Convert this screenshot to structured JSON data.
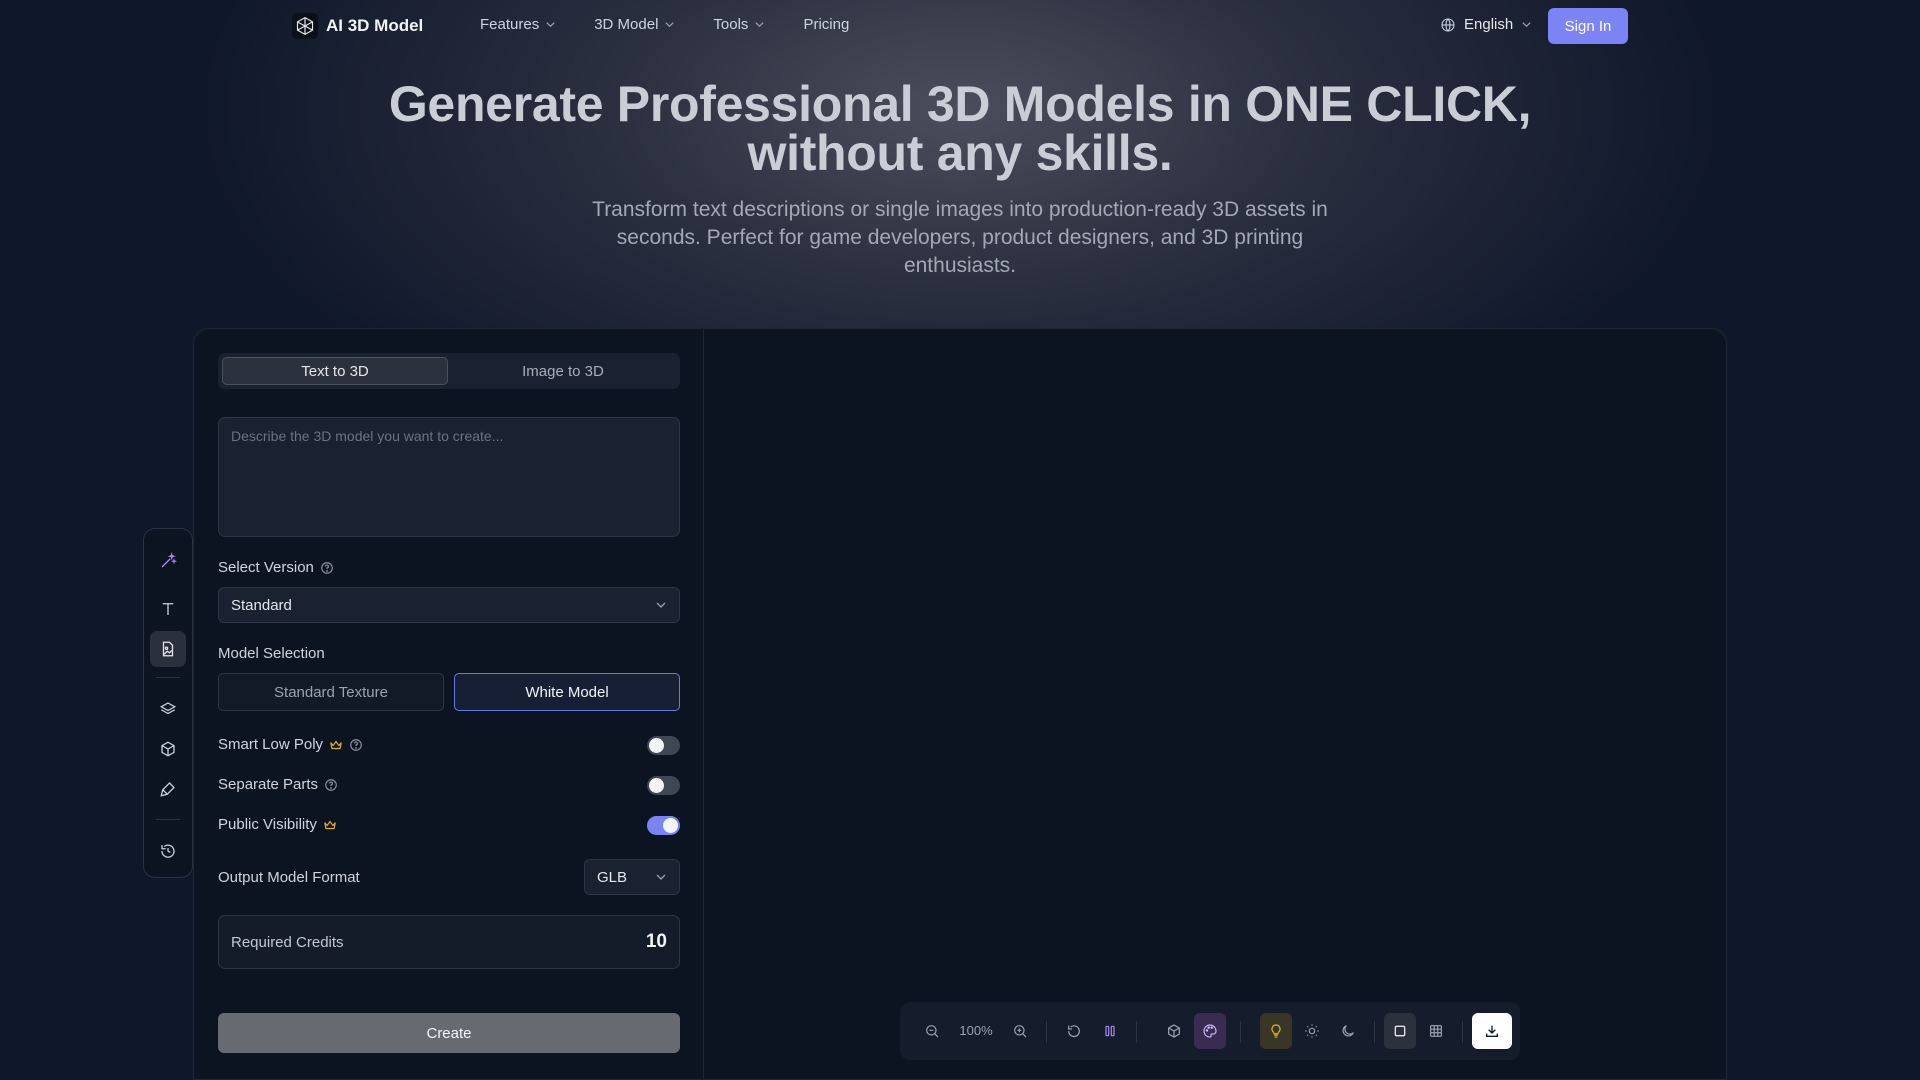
{
  "nav": {
    "brand": "AI 3D Model",
    "links": [
      {
        "label": "Features",
        "dropdown": true
      },
      {
        "label": "3D Model",
        "dropdown": true
      },
      {
        "label": "Tools",
        "dropdown": true
      },
      {
        "label": "Pricing",
        "dropdown": false
      }
    ],
    "language": "English",
    "sign_in": "Sign In"
  },
  "hero": {
    "title_line1": "Generate Professional 3D Models in ONE CLICK,",
    "title_line2": "without any skills.",
    "subtitle": "Transform text descriptions or single images into production-ready 3D assets in seconds. Perfect for game developers, product designers, and 3D printing enthusiasts."
  },
  "generator": {
    "tabs": [
      {
        "label": "Text to 3D",
        "active": true
      },
      {
        "label": "Image to 3D",
        "active": false
      }
    ],
    "prompt_placeholder": "Describe the 3D model you want to create...",
    "version_label": "Select Version",
    "version_value": "Standard",
    "model_selection_label": "Model Selection",
    "model_options": [
      {
        "label": "Standard Texture",
        "selected": false
      },
      {
        "label": "White Model",
        "selected": true
      }
    ],
    "toggles": [
      {
        "label": "Smart Low Poly",
        "premium": true,
        "help": true,
        "on": false
      },
      {
        "label": "Separate Parts",
        "premium": false,
        "help": true,
        "on": false
      },
      {
        "label": "Public Visibility",
        "premium": true,
        "help": false,
        "on": true
      }
    ],
    "output_format_label": "Output Model Format",
    "output_format_value": "GLB",
    "credits_label": "Required Credits",
    "credits_value": "10",
    "create_label": "Create"
  },
  "viewer_toolbar": {
    "zoom": "100%"
  },
  "colors": {
    "accent": "#7c83f5",
    "background": "#0f172a",
    "panel": "#0d1421",
    "premium_crown": "#e0b227",
    "rail_active_icon": "#a78bfa"
  }
}
